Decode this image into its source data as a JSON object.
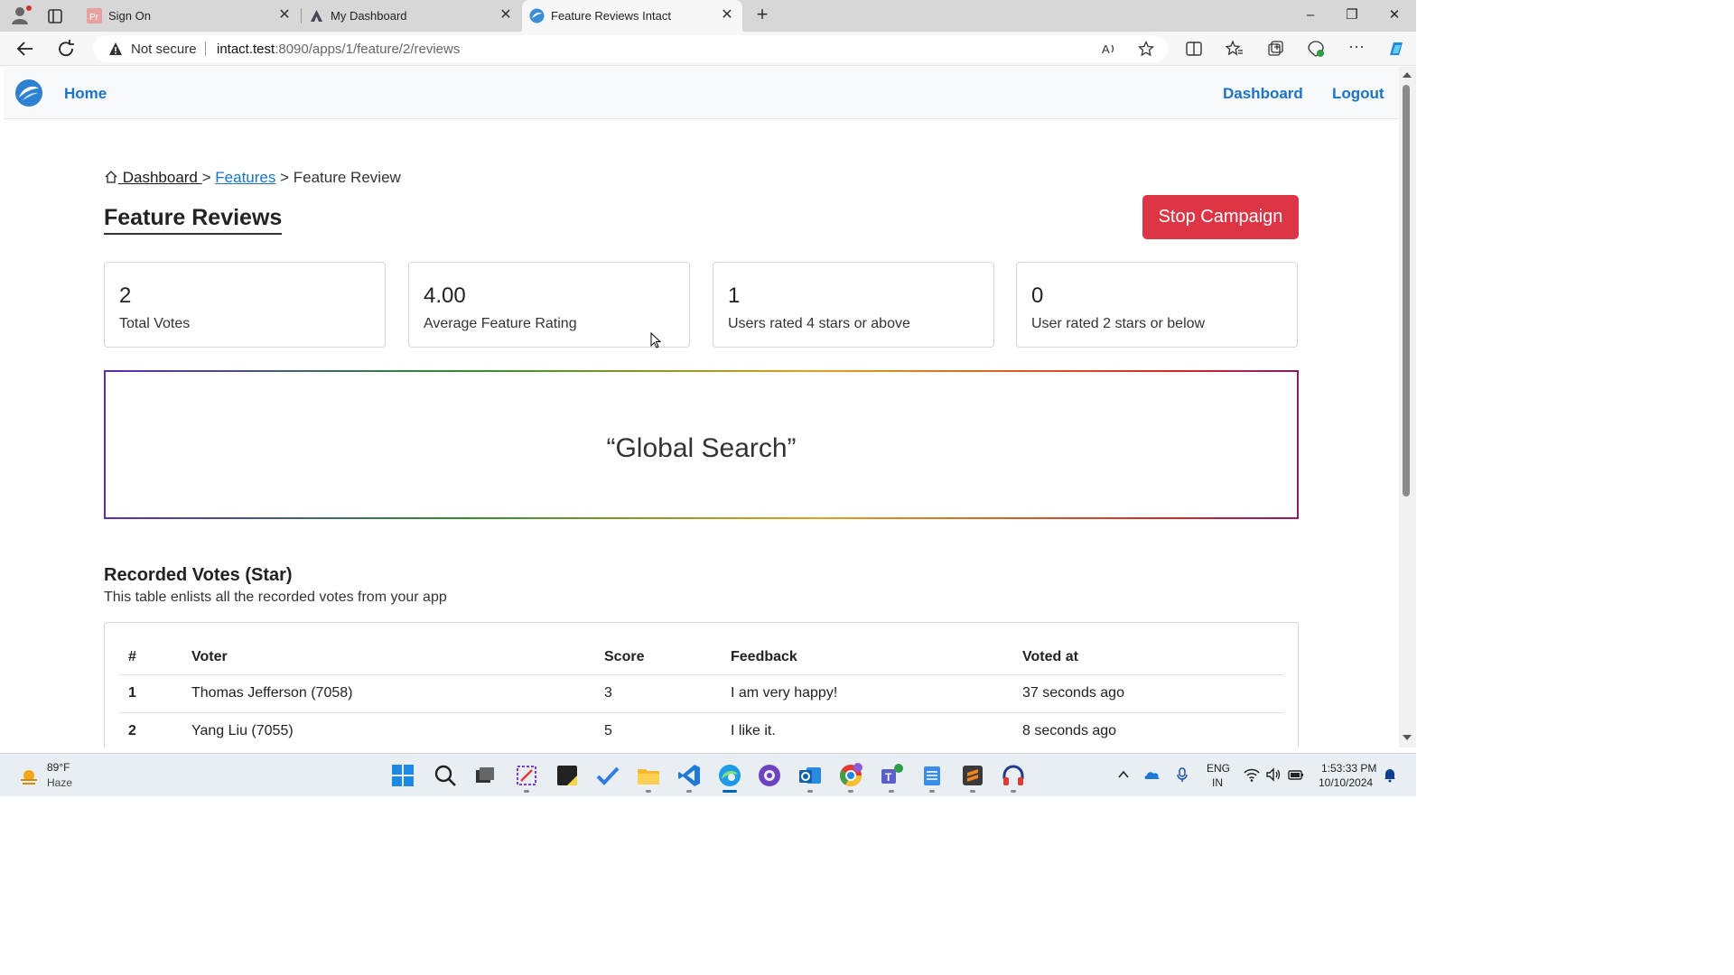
{
  "browser": {
    "tabs": [
      {
        "title": "Sign On",
        "favicon": "pr-icon",
        "active": false
      },
      {
        "title": "My Dashboard",
        "favicon": "atlassian-icon",
        "active": false
      },
      {
        "title": "Feature Reviews Intact",
        "favicon": "intact-logo-icon",
        "active": true
      }
    ],
    "address": {
      "security_label": "Not secure",
      "host": "intact.test",
      "path": ":8090/apps/1/feature/2/reviews"
    }
  },
  "navbar": {
    "home_label": "Home",
    "dashboard_label": "Dashboard",
    "logout_label": "Logout"
  },
  "breadcrumb": {
    "dashboard": " Dashboard ",
    "sep1": " > ",
    "features": "Features",
    "sep2": " > ",
    "current": "Feature Review"
  },
  "page": {
    "title": "Feature Reviews",
    "stop_button": "Stop Campaign"
  },
  "stats": [
    {
      "value": "2",
      "label": "Total Votes"
    },
    {
      "value": "4.00",
      "label": "Average Feature Rating"
    },
    {
      "value": "1",
      "label": "Users rated 4 stars or above"
    },
    {
      "value": "0",
      "label": "User rated 2 stars or below"
    }
  ],
  "search_box": {
    "text": "“Global Search”"
  },
  "votes": {
    "title": "Recorded Votes (Star)",
    "subtitle": "This table enlists all the recorded votes from your app",
    "headers": [
      "#",
      "Voter",
      "Score",
      "Feedback",
      "Voted at"
    ],
    "rows": [
      {
        "num": "1",
        "voter": "Thomas Jefferson (7058)",
        "score": "3",
        "feedback": "I am very happy!",
        "voted_at": "37 seconds ago"
      },
      {
        "num": "2",
        "voter": "Yang Liu (7055)",
        "score": "5",
        "feedback": "I like it.",
        "voted_at": "8 seconds ago"
      }
    ]
  },
  "taskbar": {
    "weather_temp": "89°F",
    "weather_desc": "Haze",
    "lang_line1": "ENG",
    "lang_line2": "IN",
    "time": "1:53:33 PM",
    "date": "10/10/2024"
  },
  "colors": {
    "accent": "#1a73c8",
    "danger": "#dc3545"
  }
}
